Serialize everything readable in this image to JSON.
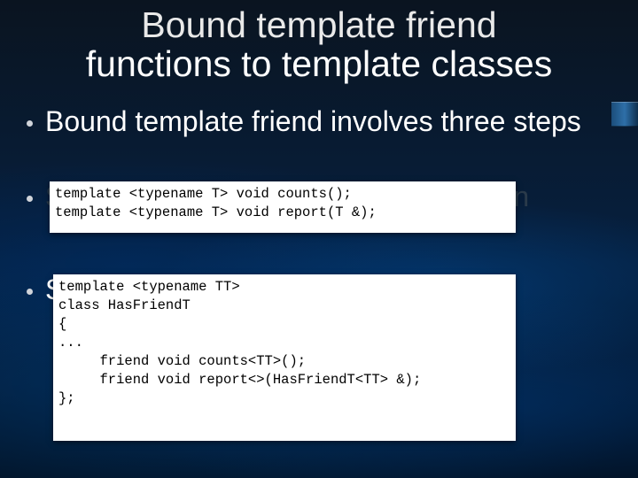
{
  "title_l1": "Bound template friend",
  "title_l2": "functions to template classes",
  "bullets": {
    "b1": "Bound template friend involves three steps",
    "b2_hidden": "Step 1: declare each template function",
    "b3_prefix": "S"
  },
  "code1": "template <typename T> void counts();\ntemplate <typename T> void report(T &);",
  "code2": "template <typename TT>\nclass HasFriendT\n{\n...\n     friend void counts<TT>();\n     friend void report<>(HasFriendT<TT> &);\n};"
}
